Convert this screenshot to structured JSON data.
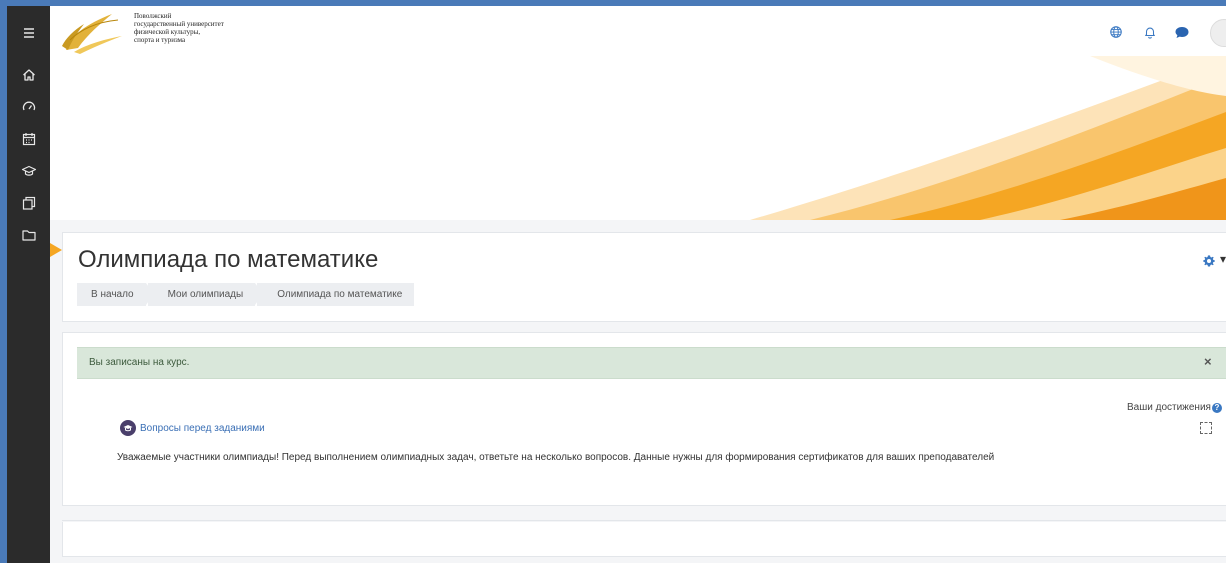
{
  "header": {
    "logo_lines": [
      "Поволжский",
      "государственный университет",
      "физической культуры,",
      "спорта и туризма"
    ]
  },
  "sidebar": {
    "items": [
      {
        "icon": "menu-icon"
      },
      {
        "icon": "home-icon"
      },
      {
        "icon": "dashboard-icon"
      },
      {
        "icon": "calendar-icon"
      },
      {
        "icon": "graduation-cap-icon"
      },
      {
        "icon": "content-bank-icon"
      },
      {
        "icon": "folder-icon"
      }
    ]
  },
  "course": {
    "title": "Олимпиада по математике",
    "breadcrumb": [
      "В начало",
      "Мои олимпиады",
      "Олимпиада по математике"
    ]
  },
  "alert": {
    "text": "Вы записаны на курс.",
    "close": "×"
  },
  "achievements": {
    "label": "Ваши достижения",
    "help": "?"
  },
  "activity": {
    "title": "Вопросы перед заданиями",
    "description": "Уважаемые участники олимпиады! Перед выполнением олимпиадных задач, ответьте на несколько вопросов. Данные нужны для формирования сертификатов для ваших преподавателей"
  },
  "colors": {
    "sidebar": "#2b2b2b",
    "accent": "#3a78c2",
    "alert_bg": "#d9e7da",
    "banner_orange": "#f5a623"
  }
}
